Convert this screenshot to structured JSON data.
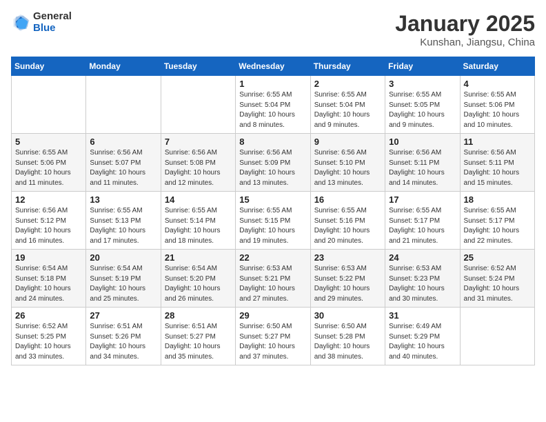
{
  "header": {
    "logo_general": "General",
    "logo_blue": "Blue",
    "month_title": "January 2025",
    "location": "Kunshan, Jiangsu, China"
  },
  "days_of_week": [
    "Sunday",
    "Monday",
    "Tuesday",
    "Wednesday",
    "Thursday",
    "Friday",
    "Saturday"
  ],
  "weeks": [
    [
      {
        "day": "",
        "info": ""
      },
      {
        "day": "",
        "info": ""
      },
      {
        "day": "",
        "info": ""
      },
      {
        "day": "1",
        "info": "Sunrise: 6:55 AM\nSunset: 5:04 PM\nDaylight: 10 hours\nand 8 minutes."
      },
      {
        "day": "2",
        "info": "Sunrise: 6:55 AM\nSunset: 5:04 PM\nDaylight: 10 hours\nand 9 minutes."
      },
      {
        "day": "3",
        "info": "Sunrise: 6:55 AM\nSunset: 5:05 PM\nDaylight: 10 hours\nand 9 minutes."
      },
      {
        "day": "4",
        "info": "Sunrise: 6:55 AM\nSunset: 5:06 PM\nDaylight: 10 hours\nand 10 minutes."
      }
    ],
    [
      {
        "day": "5",
        "info": "Sunrise: 6:55 AM\nSunset: 5:06 PM\nDaylight: 10 hours\nand 11 minutes."
      },
      {
        "day": "6",
        "info": "Sunrise: 6:56 AM\nSunset: 5:07 PM\nDaylight: 10 hours\nand 11 minutes."
      },
      {
        "day": "7",
        "info": "Sunrise: 6:56 AM\nSunset: 5:08 PM\nDaylight: 10 hours\nand 12 minutes."
      },
      {
        "day": "8",
        "info": "Sunrise: 6:56 AM\nSunset: 5:09 PM\nDaylight: 10 hours\nand 13 minutes."
      },
      {
        "day": "9",
        "info": "Sunrise: 6:56 AM\nSunset: 5:10 PM\nDaylight: 10 hours\nand 13 minutes."
      },
      {
        "day": "10",
        "info": "Sunrise: 6:56 AM\nSunset: 5:11 PM\nDaylight: 10 hours\nand 14 minutes."
      },
      {
        "day": "11",
        "info": "Sunrise: 6:56 AM\nSunset: 5:11 PM\nDaylight: 10 hours\nand 15 minutes."
      }
    ],
    [
      {
        "day": "12",
        "info": "Sunrise: 6:56 AM\nSunset: 5:12 PM\nDaylight: 10 hours\nand 16 minutes."
      },
      {
        "day": "13",
        "info": "Sunrise: 6:55 AM\nSunset: 5:13 PM\nDaylight: 10 hours\nand 17 minutes."
      },
      {
        "day": "14",
        "info": "Sunrise: 6:55 AM\nSunset: 5:14 PM\nDaylight: 10 hours\nand 18 minutes."
      },
      {
        "day": "15",
        "info": "Sunrise: 6:55 AM\nSunset: 5:15 PM\nDaylight: 10 hours\nand 19 minutes."
      },
      {
        "day": "16",
        "info": "Sunrise: 6:55 AM\nSunset: 5:16 PM\nDaylight: 10 hours\nand 20 minutes."
      },
      {
        "day": "17",
        "info": "Sunrise: 6:55 AM\nSunset: 5:17 PM\nDaylight: 10 hours\nand 21 minutes."
      },
      {
        "day": "18",
        "info": "Sunrise: 6:55 AM\nSunset: 5:17 PM\nDaylight: 10 hours\nand 22 minutes."
      }
    ],
    [
      {
        "day": "19",
        "info": "Sunrise: 6:54 AM\nSunset: 5:18 PM\nDaylight: 10 hours\nand 24 minutes."
      },
      {
        "day": "20",
        "info": "Sunrise: 6:54 AM\nSunset: 5:19 PM\nDaylight: 10 hours\nand 25 minutes."
      },
      {
        "day": "21",
        "info": "Sunrise: 6:54 AM\nSunset: 5:20 PM\nDaylight: 10 hours\nand 26 minutes."
      },
      {
        "day": "22",
        "info": "Sunrise: 6:53 AM\nSunset: 5:21 PM\nDaylight: 10 hours\nand 27 minutes."
      },
      {
        "day": "23",
        "info": "Sunrise: 6:53 AM\nSunset: 5:22 PM\nDaylight: 10 hours\nand 29 minutes."
      },
      {
        "day": "24",
        "info": "Sunrise: 6:53 AM\nSunset: 5:23 PM\nDaylight: 10 hours\nand 30 minutes."
      },
      {
        "day": "25",
        "info": "Sunrise: 6:52 AM\nSunset: 5:24 PM\nDaylight: 10 hours\nand 31 minutes."
      }
    ],
    [
      {
        "day": "26",
        "info": "Sunrise: 6:52 AM\nSunset: 5:25 PM\nDaylight: 10 hours\nand 33 minutes."
      },
      {
        "day": "27",
        "info": "Sunrise: 6:51 AM\nSunset: 5:26 PM\nDaylight: 10 hours\nand 34 minutes."
      },
      {
        "day": "28",
        "info": "Sunrise: 6:51 AM\nSunset: 5:27 PM\nDaylight: 10 hours\nand 35 minutes."
      },
      {
        "day": "29",
        "info": "Sunrise: 6:50 AM\nSunset: 5:27 PM\nDaylight: 10 hours\nand 37 minutes."
      },
      {
        "day": "30",
        "info": "Sunrise: 6:50 AM\nSunset: 5:28 PM\nDaylight: 10 hours\nand 38 minutes."
      },
      {
        "day": "31",
        "info": "Sunrise: 6:49 AM\nSunset: 5:29 PM\nDaylight: 10 hours\nand 40 minutes."
      },
      {
        "day": "",
        "info": ""
      }
    ]
  ]
}
